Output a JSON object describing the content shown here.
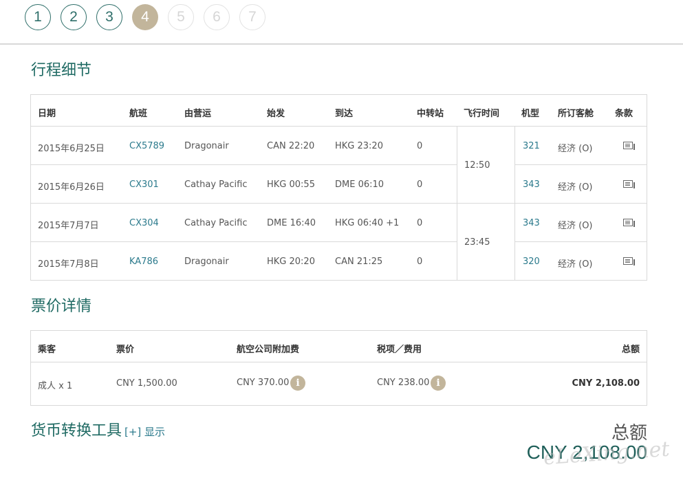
{
  "steps": [
    "1",
    "2",
    "3",
    "4",
    "5",
    "6",
    "7"
  ],
  "itinerary": {
    "title": "行程细节",
    "headers": [
      "日期",
      "航班",
      "由营运",
      "始发",
      "到达",
      "中转站",
      "飞行时间",
      "机型",
      "所订客舱",
      "条款"
    ],
    "rows": [
      {
        "date": "2015年6月25日",
        "flight": "CX5789",
        "operator": "Dragonair",
        "depart": "CAN 22:20",
        "arrive": "HKG 23:20",
        "stops": "0",
        "aircraft": "321",
        "cabin": "经济 (O)"
      },
      {
        "date": "2015年6月26日",
        "flight": "CX301",
        "operator": "Cathay Pacific",
        "depart": "HKG 00:55",
        "arrive": "DME 06:10",
        "stops": "0",
        "aircraft": "343",
        "cabin": "经济 (O)"
      },
      {
        "date": "2015年7月7日",
        "flight": "CX304",
        "operator": "Cathay Pacific",
        "depart": "DME 16:40",
        "arrive": "HKG 06:40 +1",
        "stops": "0",
        "aircraft": "343",
        "cabin": "经济 (O)"
      },
      {
        "date": "2015年7月8日",
        "flight": "KA786",
        "operator": "Dragonair",
        "depart": "HKG 20:20",
        "arrive": "CAN 21:25",
        "stops": "0",
        "aircraft": "320",
        "cabin": "经济 (O)"
      }
    ],
    "durations": [
      "12:50",
      "23:45"
    ]
  },
  "fare": {
    "title": "票价详情",
    "headers": [
      "乘客",
      "票价",
      "航空公司附加费",
      "税项／费用",
      "总额"
    ],
    "row": {
      "passenger": "成人 x 1",
      "fare": "CNY 1,500.00",
      "surcharge": "CNY 370.00",
      "tax": "CNY 238.00",
      "total": "CNY 2,108.00"
    }
  },
  "currency_tool": {
    "label": "货币转换工具",
    "toggle": "[+] 显示"
  },
  "total": {
    "label": "总额",
    "value": "CNY 2,108.00"
  },
  "watermark": "eLeXing.net",
  "icons": {
    "terms": "document-icon",
    "info": "info-icon"
  },
  "colors": {
    "accent": "#1f6a63",
    "step_current": "#c2b59b",
    "link": "#2b7a8c"
  }
}
